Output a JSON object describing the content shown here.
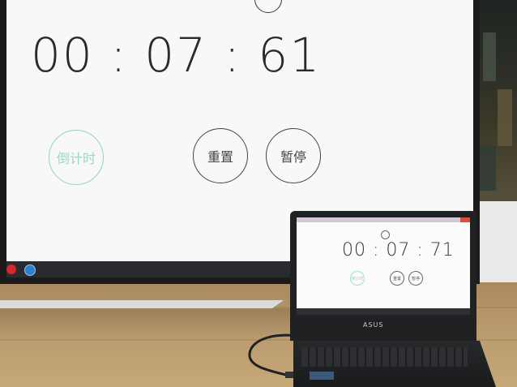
{
  "big_screen": {
    "time": "00 : 07 : 61",
    "countdown_label": "倒计时",
    "reset_label": "重置",
    "pause_label": "暂停"
  },
  "laptop_screen": {
    "time": "00 : 07 : 71",
    "countdown_label": "倒计时",
    "reset_label": "重置",
    "pause_label": "暂停",
    "logo": "ASUS"
  },
  "colors": {
    "countdown_accent": "#8fd3c6",
    "taskbar_red": "#d7262c",
    "taskbar_blue": "#2d7fd2"
  },
  "icons": [
    "top-circle-icon",
    "taskbar-app-icon-red",
    "taskbar-app-icon-blue"
  ]
}
